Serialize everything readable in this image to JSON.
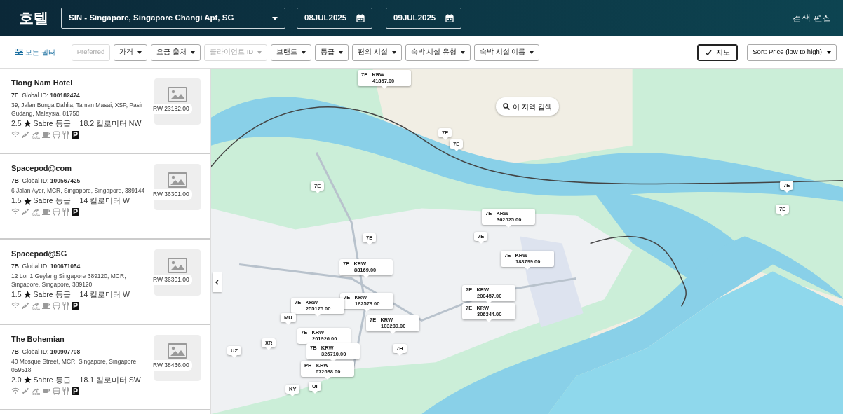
{
  "header": {
    "title": "호텔",
    "location": "SIN - Singapore, Singapore Changi Apt, SG",
    "check_in": "08JUL2025",
    "check_out": "09JUL2025",
    "edit_link": "검색 편집"
  },
  "filters": {
    "all_filters": "모든 필터",
    "buttons": [
      {
        "label": "Preferred",
        "dropdown": false,
        "disabled": true
      },
      {
        "label": "가격",
        "dropdown": true,
        "disabled": false
      },
      {
        "label": "요금 출처",
        "dropdown": true,
        "disabled": false
      },
      {
        "label": "클라이언트 ID",
        "dropdown": true,
        "disabled": true
      },
      {
        "label": "브랜드",
        "dropdown": true,
        "disabled": false
      },
      {
        "label": "등급",
        "dropdown": true,
        "disabled": false
      },
      {
        "label": "편의 시설",
        "dropdown": true,
        "disabled": false
      },
      {
        "label": "숙박 시설 유형",
        "dropdown": true,
        "disabled": false
      },
      {
        "label": "숙박 시설 이름",
        "dropdown": true,
        "disabled": false
      }
    ],
    "map_toggle": {
      "label": "지도",
      "selected": true
    },
    "sort": "Sort: Price (low to high)"
  },
  "hotels": [
    {
      "name": "Tiong Nam Hotel",
      "chain": "7E",
      "global_id_label": "Global ID:",
      "global_id": "100182474",
      "address": "39, Jalan Bunga Dahlia, Taman Masai, XSP, Pasir Gudang, Malaysia, 81750",
      "rating": "2.5",
      "rating_label": "Sabre 등급",
      "distance": "18.2 킬로미터 NW",
      "price": "RW 23182.00",
      "amenities": [
        {
          "kind": "wifi",
          "available": false
        },
        {
          "kind": "satellite",
          "available": false
        },
        {
          "kind": "pool",
          "available": false
        },
        {
          "kind": "breakfast",
          "available": false
        },
        {
          "kind": "shuttle",
          "available": false
        },
        {
          "kind": "restaurant",
          "available": false
        },
        {
          "kind": "parking",
          "available": true
        }
      ]
    },
    {
      "name": "Spacepod@com",
      "chain": "7B",
      "global_id_label": "Global ID:",
      "global_id": "100567425",
      "address": "6 Jalan Ayer, MCR, Singapore, Singapore, 389144",
      "rating": "1.5",
      "rating_label": "Sabre 등급",
      "distance": "14 킬로미터 W",
      "price": "RW 36301.00",
      "amenities": [
        {
          "kind": "wifi",
          "available": false
        },
        {
          "kind": "satellite",
          "available": false
        },
        {
          "kind": "pool",
          "available": false
        },
        {
          "kind": "breakfast",
          "available": false
        },
        {
          "kind": "shuttle",
          "available": false
        },
        {
          "kind": "restaurant",
          "available": false
        },
        {
          "kind": "parking",
          "available": true
        }
      ]
    },
    {
      "name": "Spacepod@SG",
      "chain": "7B",
      "global_id_label": "Global ID:",
      "global_id": "100671054",
      "address": "12 Lor 1 Geylang Singapore 389120, MCR, Singapore, Singapore, 389120",
      "rating": "1.5",
      "rating_label": "Sabre 등급",
      "distance": "14 킬로미터 W",
      "price": "RW 36301.00",
      "amenities": [
        {
          "kind": "wifi",
          "available": false
        },
        {
          "kind": "satellite",
          "available": false
        },
        {
          "kind": "pool",
          "available": false
        },
        {
          "kind": "breakfast",
          "available": false
        },
        {
          "kind": "shuttle",
          "available": false
        },
        {
          "kind": "restaurant",
          "available": false
        },
        {
          "kind": "parking",
          "available": true
        }
      ]
    },
    {
      "name": "The Bohemian",
      "chain": "7B",
      "global_id_label": "Global ID:",
      "global_id": "100907708",
      "address": "40 Mosque Street, MCR, Singapore, Singapore, 059518",
      "rating": "2.0",
      "rating_label": "Sabre 등급",
      "distance": "18.1 킬로미터 SW",
      "price": "RW 38436.00",
      "amenities": [
        {
          "kind": "wifi",
          "available": false
        },
        {
          "kind": "satellite",
          "available": false
        },
        {
          "kind": "pool",
          "available": false
        },
        {
          "kind": "breakfast",
          "available": false
        },
        {
          "kind": "shuttle",
          "available": false
        },
        {
          "kind": "restaurant",
          "available": false
        },
        {
          "kind": "parking",
          "available": true
        }
      ]
    }
  ],
  "map": {
    "search_area": "이 지역 검색",
    "markers": [
      {
        "kind": "price",
        "chain": "7E",
        "currency": "KRW",
        "price": "41857.00"
      },
      {
        "kind": "price",
        "chain": "7E",
        "currency": "KRW",
        "price": "362525.00"
      },
      {
        "kind": "price",
        "chain": "7E",
        "currency": "KRW",
        "price": "188799.00"
      },
      {
        "kind": "price",
        "chain": "7E",
        "currency": "KRW",
        "price": "88169.00"
      },
      {
        "kind": "price",
        "chain": "7E",
        "currency": "KRW",
        "price": "182573.00"
      },
      {
        "kind": "price",
        "chain": "7E",
        "currency": "KRW",
        "price": "255175.00"
      },
      {
        "kind": "price",
        "chain": "7E",
        "currency": "KRW",
        "price": "200457.00"
      },
      {
        "kind": "price",
        "chain": "7E",
        "currency": "KRW",
        "price": "306344.00"
      },
      {
        "kind": "price",
        "chain": "7E",
        "currency": "KRW",
        "price": "103289.00"
      },
      {
        "kind": "price",
        "chain": "7E",
        "currency": "KRW",
        "price": "201926.00"
      },
      {
        "kind": "price",
        "chain": "7B",
        "currency": "KRW",
        "price": "326710.00"
      },
      {
        "kind": "price",
        "chain": "PH",
        "currency": "KRW",
        "price": "672638.00"
      },
      {
        "kind": "chain",
        "chain": "7E"
      },
      {
        "kind": "chain",
        "chain": "7E"
      },
      {
        "kind": "chain",
        "chain": "7E"
      },
      {
        "kind": "chain",
        "chain": "7E"
      },
      {
        "kind": "chain",
        "chain": "7E"
      },
      {
        "kind": "chain",
        "chain": "7E"
      },
      {
        "kind": "chain",
        "chain": "7E"
      },
      {
        "kind": "chain",
        "chain": "7H"
      },
      {
        "kind": "chain",
        "chain": "MU"
      },
      {
        "kind": "chain",
        "chain": "XR"
      },
      {
        "kind": "chain",
        "chain": "UZ"
      },
      {
        "kind": "chain",
        "chain": "KY"
      },
      {
        "kind": "chain",
        "chain": "UI"
      }
    ]
  }
}
